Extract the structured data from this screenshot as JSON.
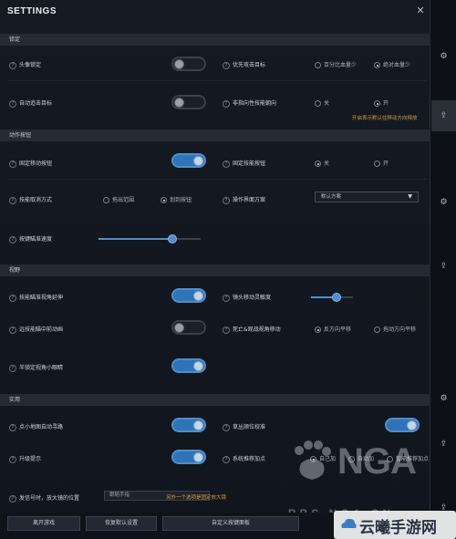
{
  "window": {
    "title": "SETTINGS",
    "close_glyph": "✕"
  },
  "sections": {
    "lock": "锁定",
    "action_button": "动作按钮",
    "view": "视野",
    "practical": "实用"
  },
  "lock": {
    "head_lock": {
      "label": "头像锁定",
      "state": "off"
    },
    "priority_target": {
      "label": "优先攻击目标",
      "options": [
        "百分比血量少",
        "绝对血量少"
      ],
      "selected": 1
    },
    "auto_target": {
      "label": "自动追击目标",
      "state": "off"
    },
    "non_directional": {
      "label": "非指向性技能朝向",
      "options": [
        "关",
        "开"
      ],
      "selected": 1,
      "hint": "开启表示默认往移动方向释放"
    }
  },
  "action_button": {
    "fixed_move": {
      "label": "固定移动按钮",
      "state": "on"
    },
    "fixed_skill": {
      "label": "固定技能按钮",
      "options": [
        "关",
        "开"
      ],
      "selected": 0
    },
    "cancel_mode": {
      "label": "技能取消方式",
      "options": [
        "拖出范围",
        "划到按钮"
      ],
      "selected": 1
    },
    "control_scheme": {
      "label": "操作界面方案",
      "value": "默认方案",
      "caret": "▼"
    },
    "sensitivity": {
      "label": "按键瞄准速度",
      "value": 0.72
    }
  },
  "view": {
    "aim_camera": {
      "label": "技能瞄准视角延伸",
      "state": "on"
    },
    "far_camera": {
      "label": "远技能瞄中前动画",
      "state": "off"
    },
    "half_lock": {
      "label": "半锁定视角小眼睛",
      "state": "on"
    },
    "lens_move": {
      "label": "镜头移动灵敏度",
      "value": 0.6
    },
    "death_camera": {
      "label": "死亡&观战视角移动",
      "options": [
        "反方向平移",
        "拖动方向平移"
      ],
      "selected": 0
    }
  },
  "practical": {
    "minimap_auto": {
      "label": "点小地图自动寻路",
      "state": "on"
    },
    "scoreboard_verify": {
      "label": "草丛顺位校准",
      "state": "on"
    },
    "level_hint": {
      "label": "升级提示",
      "state": "on"
    },
    "system_recommend": {
      "label": "系统推荐加点",
      "options": [
        "自己加",
        "自动加",
        "智能推荐加点"
      ],
      "selected": 0
    },
    "send_signal": {
      "label": "发信号时，放大镜的位置",
      "input_value": "跟随手指",
      "hint": "另外一个选项是固定放大镜"
    }
  },
  "buttons": {
    "leave_game": "离开游戏",
    "restore_default": "恢复默认设置",
    "custom_key": "自定义按键面板"
  },
  "side_tabs": [
    {
      "icon": "gear-icon",
      "glyph": "⚙",
      "active": false
    },
    {
      "icon": "upload-icon",
      "glyph": "⇪",
      "active": true
    },
    {
      "icon": "gear-icon",
      "glyph": "⚙",
      "active": false
    },
    {
      "icon": "upload-icon",
      "glyph": "⇪",
      "active": false
    },
    {
      "icon": "gear-icon",
      "glyph": "⚙",
      "active": false
    },
    {
      "icon": "upload-icon",
      "glyph": "⇪",
      "active": false
    },
    {
      "icon": "upload-icon",
      "glyph": "⇪",
      "active": false
    }
  ],
  "watermark": {
    "text": "NGA",
    "sub": "BBS.NGA.CN"
  },
  "brand": {
    "text": "云曦手游网"
  },
  "colors": {
    "accent": "#2f74b8",
    "hint": "#d89a40",
    "panel": "#151922"
  }
}
